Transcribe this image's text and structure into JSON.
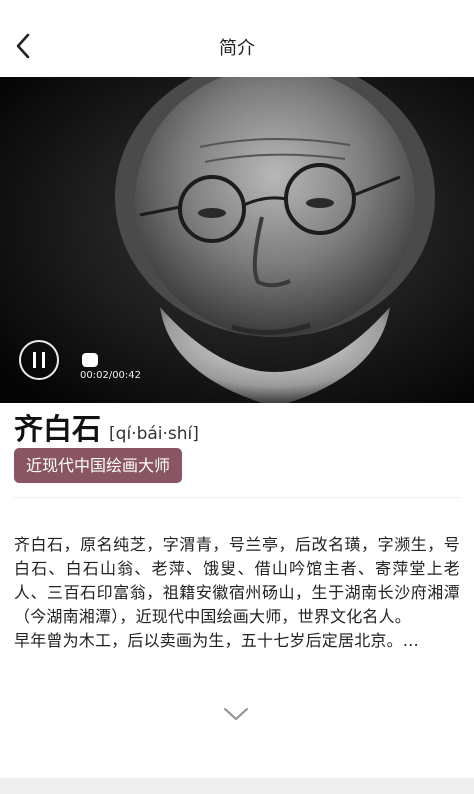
{
  "header": {
    "back_icon": "chevron-left-icon",
    "title": "简介"
  },
  "media": {
    "play_state_icon": "pause-icon",
    "time": "00:02/00:42",
    "progress_fraction": 0.05
  },
  "person": {
    "name": "齐白石",
    "pinyin": "[qí·bái·shí]",
    "tag": "近现代中国绘画大师"
  },
  "bio": {
    "para1": "齐白石，原名纯芝，字渭青，号兰亭，后改名璜，字濒生，号白石、白石山翁、老萍、饿叟、借山吟馆主者、寄萍堂上老人、三百石印富翁，祖籍安徽宿州砀山，生于湖南长沙府湘潭（今湖南湘潭），近现代中国绘画大师，世界文化名人。",
    "para2": "早年曾为木工，后以卖画为生，五十七岁后定居北京。…"
  },
  "expand_icon": "chevron-down-icon",
  "colors": {
    "tag_bg": "#8a5562",
    "background": "#ffffff"
  }
}
